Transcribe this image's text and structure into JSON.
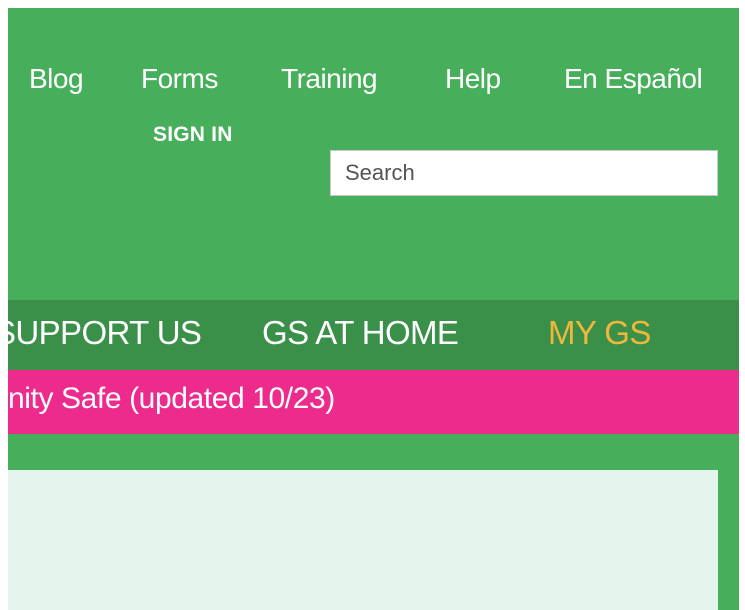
{
  "utility_nav": {
    "blog": "Blog",
    "forms": "Forms",
    "training": "Training",
    "help": "Help",
    "espanol": "En Español"
  },
  "account": {
    "sign_in": "SIGN IN"
  },
  "search": {
    "placeholder": "Search"
  },
  "main_nav": {
    "support_us": "SUPPORT US",
    "gs_at_home": "GS AT HOME",
    "my_gs": "MY GS"
  },
  "alert": {
    "text": "nity Safe (updated 10/23)"
  },
  "colors": {
    "header_green": "#47ae5b",
    "nav_green": "#3a8f49",
    "alert_pink": "#ec2b8c",
    "active_gold": "#f0b73c",
    "panel_mint": "#e4f5ee"
  }
}
